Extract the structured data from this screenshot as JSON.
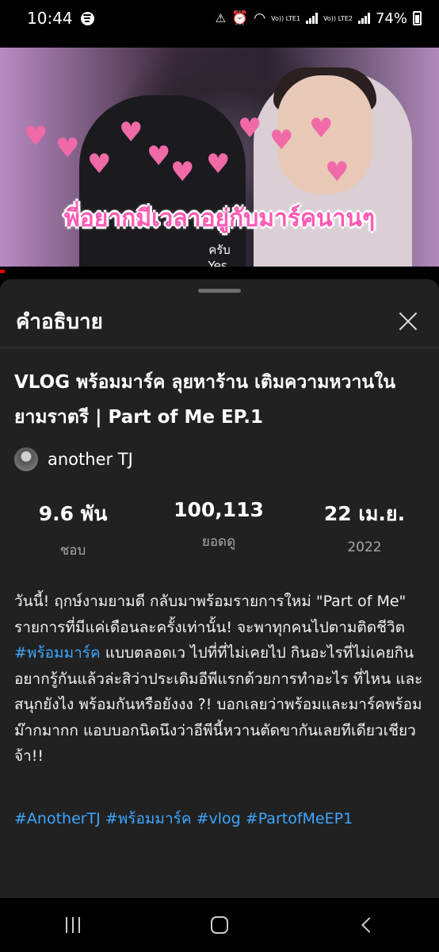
{
  "status_bar": {
    "time": "10:44",
    "sim1_label": "Vo)) LTE1",
    "sim2_label": "Vo)) LTE2",
    "battery_percent": "74%"
  },
  "video": {
    "caption_th": "พี่อยากมีเวลาอยู่กับมาร์คนานๆ",
    "subtitle_th": "ครับ",
    "subtitle_en": "Yes.",
    "progress": 0.01,
    "progress_color": "#ff0000"
  },
  "description_sheet": {
    "title": "คำอธิบาย",
    "video_title": "VLOG พร้อมมาร์ค ลุยหาร้าน เติมความหวานในยามราตรี | Part of Me EP.1",
    "channel_name": "another TJ",
    "stats": [
      {
        "value": "9.6 พัน",
        "label": "ชอบ"
      },
      {
        "value": "100,113",
        "label": "ยอดดู"
      },
      {
        "value": "22 เม.ย.",
        "label": "2022"
      }
    ],
    "description_part1": "วันนี้! ฤกษ์งามยามดี กลับมาพร้อมรายการใหม่ \"Part of Me\" รายการที่มีแค่เดือนละครั้งเท่านั้น! จะพาทุกคนไปตามติดชีวิต ",
    "description_hashtag": "#พร้อมมาร์ค",
    "description_part2": " แบบตลอดเว ไปที่ที่ไม่เคยไป กินอะไรที่ไม่เคยกิน อยากรู้กันแล้วล่ะสิว่าประเดิมอีพีแรกด้วยการทำอะไร ที่ไหน และสนุกยังไง พร้อมกันหรือยังงง ?! บอกเลยว่าพร้อมและมาร์คพร้อมม๊ากมากก แอบบอกนิดนึงว่าอีพีนี้หวานตัดขากันเลยทีเดียวเชียวจ้า!!",
    "hashtags": [
      "#AnotherTJ",
      "#พร้อมมาร์ค",
      "#vlog",
      "#PartofMeEP1"
    ],
    "link_color": "#3ea6ff"
  }
}
